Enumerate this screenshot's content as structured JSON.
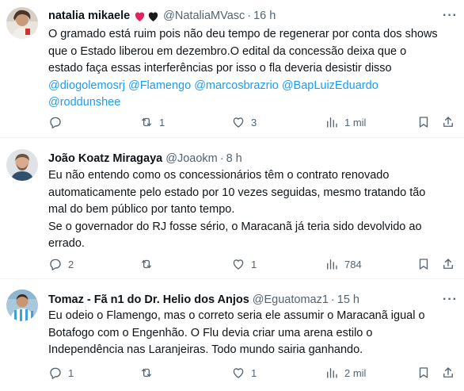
{
  "tweets": [
    {
      "name": "natalia mikaele",
      "handle": "@NataliaMVasc",
      "sep": "·",
      "time": "16 h",
      "name_emoji": [
        "red-heart",
        "black-heart"
      ],
      "text_line1": "O gramado está ruim pois não deu tempo de regenerar por conta dos shows",
      "text_line2": "que o Estado liberou em dezembro.O edital da concessão deixa que o",
      "text_line3": "estado faça essas interferências por isso o fla deveria desistir disso",
      "mentions": [
        "@diogolemosrj",
        "@Flamengo",
        "@marcosbrazrio",
        "@BapLuizEduardo",
        "@roddunshee"
      ],
      "replies": "",
      "retweets": "1",
      "likes": "3",
      "views": "1 mil"
    },
    {
      "name": "João Koatz Miragaya",
      "handle": "@Joaokm",
      "sep": "·",
      "time": "8 h",
      "text_line1": "Eu não entendo como os concessionários têm o contrato renovado",
      "text_line2": "automaticamente pelo estado por 10 vezes seguidas, mesmo tratando tão",
      "text_line3": "mal do bem público por tanto tempo.",
      "text_line4": "Se o governador do RJ fosse sério, o Maracanã já teria sido devolvido ao",
      "text_line5": "errado.",
      "replies": "2",
      "retweets": "",
      "likes": "1",
      "views": "784"
    },
    {
      "name": "Tomaz - Fã n1 do Dr. Helio dos Anjos",
      "handle": "@Eguatomaz1",
      "sep": "·",
      "time": "15 h",
      "text_line1": "Eu odeio o Flamengo, mas o correto seria ele assumir o Maracanã igual o",
      "text_line2": "Botafogo com o Engenhão. O Flu devia criar uma arena estilo o",
      "text_line3": "Independência nas Laranjeiras. Todo mundo sairia ganhando.",
      "replies": "1",
      "retweets": "",
      "likes": "1",
      "views": "2 mil"
    }
  ],
  "icons": [
    "reply-icon",
    "retweet-icon",
    "like-icon",
    "views-icon",
    "bookmark-icon",
    "share-icon",
    "more-icon"
  ],
  "colors": {
    "text": "#0f1419",
    "secondary": "#536471",
    "link": "#1d9bf0",
    "divider": "#eff3f4",
    "heart_red": "#e0245e"
  }
}
